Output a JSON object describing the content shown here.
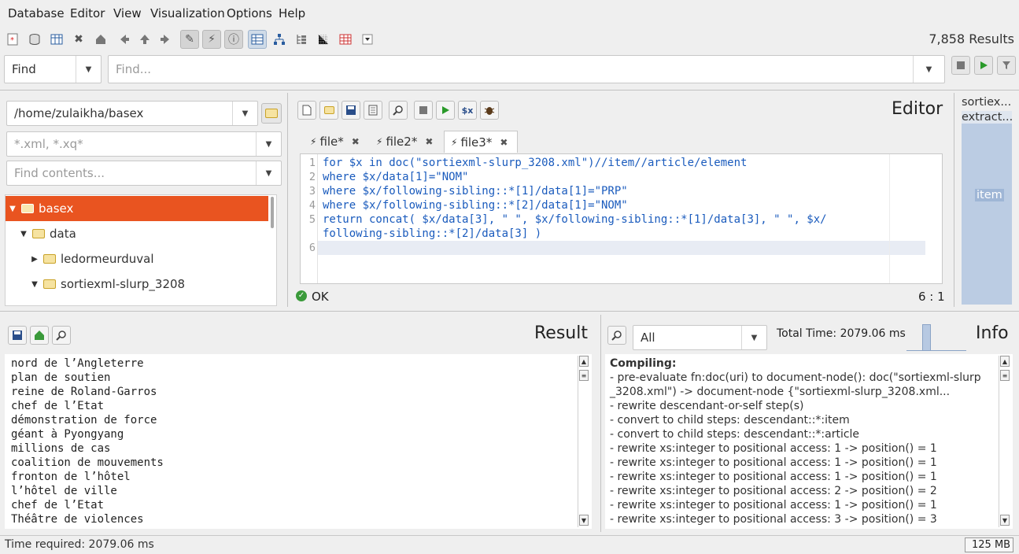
{
  "menu": [
    "Database",
    "Editor",
    "View",
    "Visualization",
    "Options",
    "Help"
  ],
  "toolbar": {
    "results_count": "7,858 Results",
    "icons": [
      "new-database-icon",
      "open-database-icon",
      "table-icon",
      "close-icon",
      "home-icon",
      "back-icon",
      "up-icon",
      "forward-icon",
      "filter-icon",
      "realtime-filter-icon",
      "info-icon",
      "table-view-icon",
      "tree-view-icon",
      "folder-view-icon",
      "plot-icon",
      "map-icon",
      "more-icon"
    ]
  },
  "find": {
    "mode": "Find",
    "placeholder": "Find..."
  },
  "explorer": {
    "path": "/home/zulaikha/basex",
    "filter_placeholder": "*.xml, *.xq*",
    "contents_placeholder": "Find contents...",
    "tree": [
      {
        "label": "basex",
        "depth": 0,
        "expanded": true,
        "selected": true
      },
      {
        "label": "data",
        "depth": 1,
        "expanded": true,
        "selected": false
      },
      {
        "label": "ledormeurduval",
        "depth": 2,
        "expanded": false,
        "selected": false
      },
      {
        "label": "sortiexml-slurp_3208",
        "depth": 2,
        "expanded": true,
        "selected": false
      }
    ]
  },
  "editor": {
    "title": "Editor",
    "tabs": [
      {
        "label": "file*"
      },
      {
        "label": "file2*"
      },
      {
        "label": "file3*"
      }
    ],
    "lines": [
      "1",
      "2",
      "3",
      "4",
      "5",
      "",
      "6"
    ],
    "code": [
      "for $x in doc(\"sortiexml-slurp_3208.xml\")//item//article/element",
      "where $x/data[1]=\"NOM\"",
      "where $x/following-sibling::*[1]/data[1]=\"PRP\"",
      "where $x/following-sibling::*[2]/data[1]=\"NOM\"",
      "return concat( $x/data[3], \" \", $x/following-sibling::*[1]/data[3], \" \", $x/",
      "following-sibling::*[2]/data[3] )"
    ],
    "status": "OK",
    "cursor": "6 : 1"
  },
  "visualization": {
    "labels": [
      "sortiex...",
      "extract...",
      "item"
    ]
  },
  "result": {
    "title": "Result",
    "lines": [
      "nord de l’Angleterre",
      "plan de soutien",
      "reine de Roland-Garros",
      "chef de l’Etat",
      "démonstration de force",
      "géant à Pyongyang",
      "millions de cas",
      "coalition de mouvements",
      "fronton de l’hôtel",
      "l’hôtel de ville",
      "chef de l’Etat",
      "Théâtre de violences"
    ]
  },
  "info": {
    "title": "Info",
    "filter": "All",
    "total_time": "Total Time: 2079.06 ms",
    "lines": [
      "Compiling:",
      "- pre-evaluate fn:doc(uri) to document-node(): doc(\"sortiexml-slurp",
      "_3208.xml\") -> document-node {\"sortiexml-slurp_3208.xml...",
      "- rewrite descendant-or-self step(s)",
      "- convert to child steps: descendant::*:item",
      "- convert to child steps: descendant::*:article",
      "- rewrite xs:integer to positional access: 1 -> position() = 1",
      "- rewrite xs:integer to positional access: 1 -> position() = 1",
      "- rewrite xs:integer to positional access: 1 -> position() = 1",
      "- rewrite xs:integer to positional access: 2 -> position() = 2",
      "- rewrite xs:integer to positional access: 1 -> position() = 1",
      "- rewrite xs:integer to positional access: 3 -> position() = 3"
    ]
  },
  "status": {
    "time": "Time required: 2079.06 ms",
    "memory": "125 MB"
  }
}
